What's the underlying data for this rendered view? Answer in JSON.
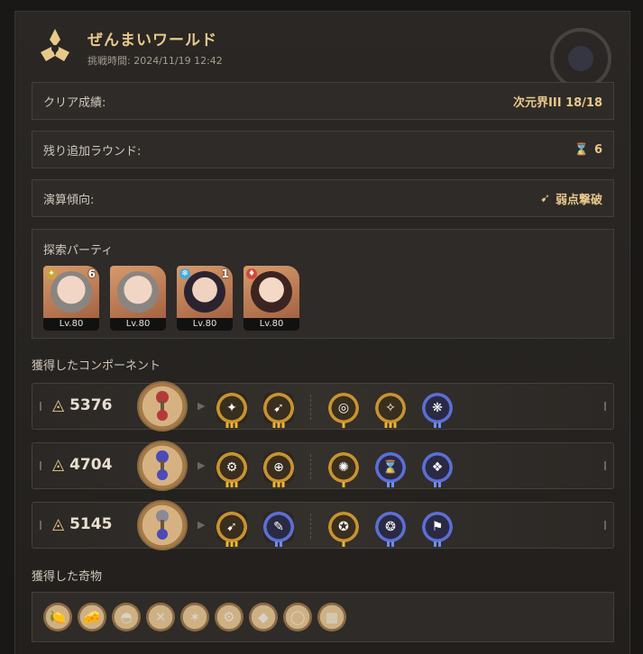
{
  "header": {
    "title": "ぜんまいワールド",
    "challenge_label": "挑戦時間",
    "challenge_time": "2024/11/19 12:42"
  },
  "rows": {
    "clear_label": "クリア成績:",
    "clear_value": "次元界III 18/18",
    "rounds_label": "残り追加ラウンド:",
    "rounds_value": "6",
    "tendency_label": "演算傾向:",
    "tendency_value": "弱点撃破"
  },
  "party": {
    "title": "探索パーティ",
    "members": [
      {
        "level": "Lv.80",
        "eidolon": "6",
        "element": "fire",
        "icon": "character-portrait-silver-hair"
      },
      {
        "level": "Lv.80",
        "eidolon": "",
        "element": "",
        "icon": "character-portrait-white-hair"
      },
      {
        "level": "Lv.80",
        "eidolon": "1",
        "element": "ice",
        "icon": "character-portrait-dark-hair"
      },
      {
        "level": "Lv.80",
        "eidolon": "",
        "element": "fire",
        "icon": "character-portrait-red-bow"
      }
    ]
  },
  "components": {
    "label": "獲得したコンポーネント",
    "items": [
      {
        "score": "5376",
        "main_color": "#b43a3a"
      },
      {
        "score": "4704",
        "main_color": "#4b4ab8"
      },
      {
        "score": "5145",
        "main_color": "#8a8a96"
      }
    ]
  },
  "curios": {
    "label": "獲得した奇物",
    "items": [
      "lemon",
      "cheese",
      "cake",
      "bandage",
      "sparkle",
      "cog",
      "crystal",
      "ring",
      "book"
    ]
  },
  "colors": {
    "accent": "#e8c98a",
    "gold_ring": "#c8932f",
    "blue_ring": "#5b6fd6"
  }
}
